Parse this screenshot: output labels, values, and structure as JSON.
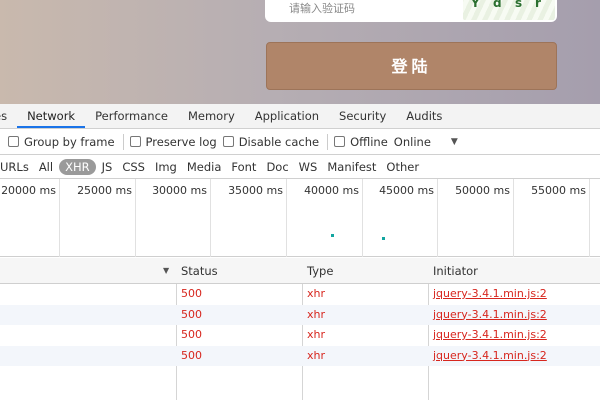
{
  "page": {
    "captcha_placeholder": "请输入验证码",
    "captcha_chars": [
      "Y",
      "d",
      "s",
      "r"
    ],
    "login_label": "登陆",
    "accent": "#b08569"
  },
  "devtools": {
    "tabs": [
      "es",
      "Network",
      "Performance",
      "Memory",
      "Application",
      "Security",
      "Audits"
    ],
    "active_tab": "Network",
    "toolbar": {
      "group_by_frame": "Group by frame",
      "preserve_log": "Preserve log",
      "disable_cache": "Disable cache",
      "offline": "Offline",
      "throttle": "Online",
      "throttle_caret": "▼"
    },
    "filters": [
      "URLs",
      "All",
      "XHR",
      "JS",
      "CSS",
      "Img",
      "Media",
      "Font",
      "Doc",
      "WS",
      "Manifest",
      "Other"
    ],
    "active_filter": "XHR",
    "timeline_ticks": [
      "20000 ms",
      "25000 ms",
      "30000 ms",
      "35000 ms",
      "40000 ms",
      "45000 ms",
      "50000 ms",
      "55000 ms"
    ],
    "table": {
      "sort_indicator": "▼",
      "columns": [
        "Status",
        "Type",
        "Initiator"
      ],
      "rows": [
        {
          "status": "500",
          "type": "xhr",
          "initiator": "jquery-3.4.1.min.js:2"
        },
        {
          "status": "500",
          "type": "xhr",
          "initiator": "jquery-3.4.1.min.js:2"
        },
        {
          "status": "500",
          "type": "xhr",
          "initiator": "jquery-3.4.1.min.js:2"
        },
        {
          "status": "500",
          "type": "xhr",
          "initiator": "jquery-3.4.1.min.js:2"
        }
      ]
    }
  }
}
